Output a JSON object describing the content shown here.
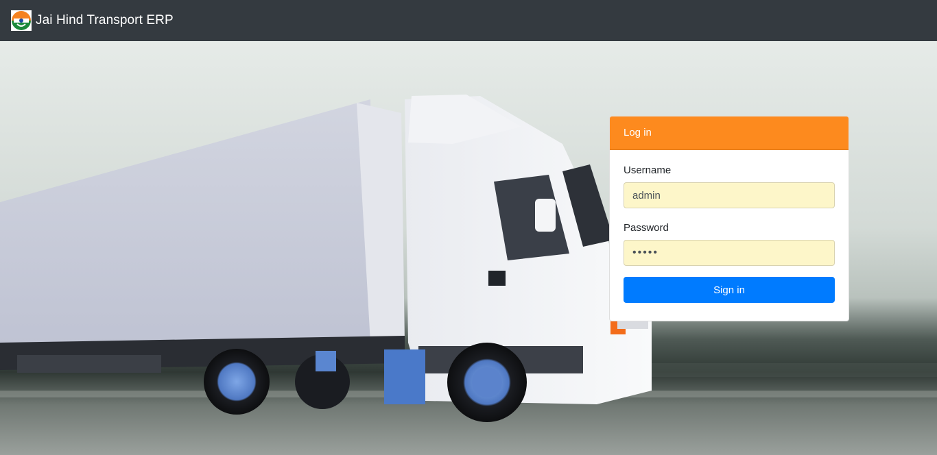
{
  "app": {
    "brand_title": "Jai Hind Transport ERP",
    "brand_icon": "jai-hind-logo-icon"
  },
  "login": {
    "header": "Log in",
    "username_label": "Username",
    "username_value": "admin",
    "password_label": "Password",
    "password_value": "admin",
    "submit_label": "Sign in"
  },
  "colors": {
    "navbar": "#343a40",
    "card_header": "#fd8a1e",
    "primary_button": "#007bff",
    "input_autofill": "#fdf6c9"
  }
}
